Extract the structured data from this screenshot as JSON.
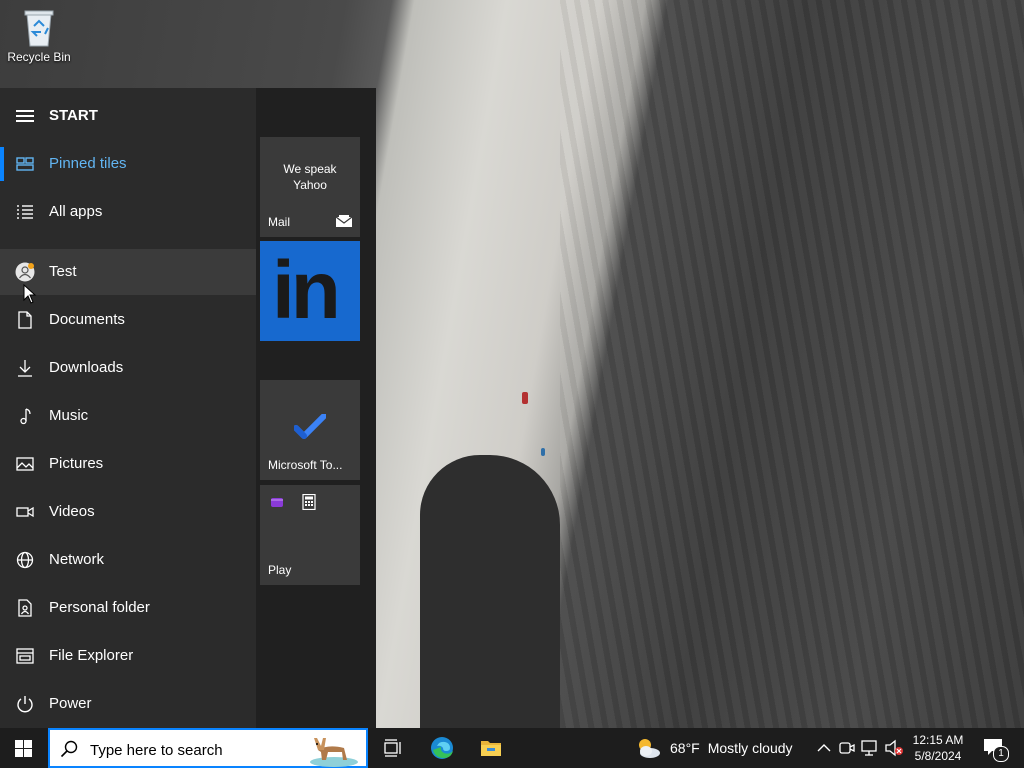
{
  "desktop": {
    "icons": [
      {
        "label": "Recycle Bin",
        "icon": "recycle-bin-icon"
      }
    ]
  },
  "start_menu": {
    "title": "START",
    "items": [
      {
        "label": "Pinned tiles",
        "icon": "pinned-tiles-icon",
        "selected": true
      },
      {
        "label": "All apps",
        "icon": "all-apps-icon"
      },
      {
        "label": "Test",
        "icon": "user-avatar-icon",
        "hover": true
      },
      {
        "label": "Documents",
        "icon": "document-icon"
      },
      {
        "label": "Downloads",
        "icon": "download-icon"
      },
      {
        "label": "Music",
        "icon": "music-note-icon"
      },
      {
        "label": "Pictures",
        "icon": "picture-icon"
      },
      {
        "label": "Videos",
        "icon": "video-icon"
      },
      {
        "label": "Network",
        "icon": "globe-icon"
      },
      {
        "label": "Personal folder",
        "icon": "personal-folder-icon"
      },
      {
        "label": "File Explorer",
        "icon": "file-explorer-icon"
      },
      {
        "label": "Power",
        "icon": "power-icon"
      }
    ]
  },
  "tiles": {
    "mail": {
      "title_line1": "We speak",
      "title_line2": "Yahoo",
      "name": "Mail"
    },
    "linkedin": {
      "logo_text": "in"
    },
    "todo": {
      "name": "Microsoft To..."
    },
    "play": {
      "name": "Play"
    }
  },
  "taskbar": {
    "search_placeholder": "Type here to search",
    "weather_temp": "68°F",
    "weather_desc": "Mostly cloudy",
    "time": "12:15 AM",
    "date": "5/8/2024",
    "notification_count": "1"
  },
  "colors": {
    "accent": "#0a84ff",
    "selected_text": "#62b5f2",
    "linkedin_blue": "#1769cf",
    "menu_bg": "#2b2b2b",
    "taskbar_bg": "#1d1d1d"
  }
}
